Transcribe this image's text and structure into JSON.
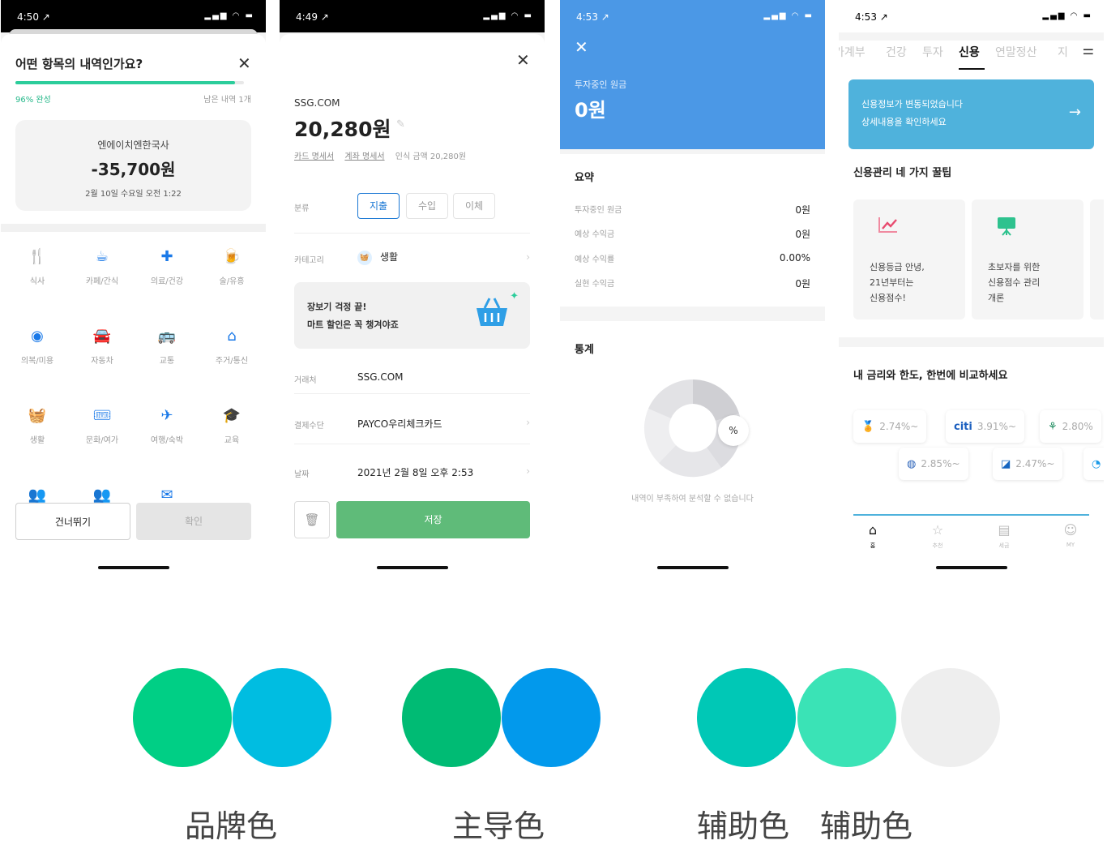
{
  "phone1": {
    "time": "4:50 ↗",
    "title": "어떤 항목의 내역인가요?",
    "progress": 0.96,
    "progress_text": "96% 완성",
    "remaining": "남은 내역 1개",
    "merchant": "엔에이치엔한국사",
    "amount": "-35,700원",
    "datetime": "2월 10일 수요일 오전 1:22",
    "categories": [
      {
        "icon": "fork-knife-icon",
        "label": "식사"
      },
      {
        "icon": "coffee-cup-icon",
        "label": "카페/간식"
      },
      {
        "icon": "medical-icon",
        "label": "의료/건강"
      },
      {
        "icon": "beer-icon",
        "label": "술/유흥"
      },
      {
        "icon": "mirror-icon",
        "label": "의복/미용"
      },
      {
        "icon": "car-icon",
        "label": "자동차"
      },
      {
        "icon": "bus-icon",
        "label": "교통"
      },
      {
        "icon": "house-icon",
        "label": "주거/통신"
      },
      {
        "icon": "basket-icon",
        "label": "생활"
      },
      {
        "icon": "ticket-icon",
        "label": "문화/여가"
      },
      {
        "icon": "plane-icon",
        "label": "여행/숙박"
      },
      {
        "icon": "graduation-cap-icon",
        "label": "교육"
      },
      {
        "icon": "people-icon",
        "label": ""
      },
      {
        "icon": "people-icon",
        "label": ""
      },
      {
        "icon": "envelope-icon",
        "label": ""
      }
    ],
    "skip_label": "건너뛰기",
    "confirm_label": "확인"
  },
  "phone2": {
    "time": "4:49 ↗",
    "merchant": "SSG.COM",
    "amount": "20,280원",
    "card_link": "카드 명세서",
    "account_link": "계좌 명세서",
    "recognized": "인식 금액 20,280원",
    "type_label": "분류",
    "types": [
      "지출",
      "수입",
      "이체"
    ],
    "category_label": "카테고리",
    "category_value": "생활",
    "promo_line1": "장보기 걱정 끝!",
    "promo_line2": "마트 할인은 꼭 챙겨야죠",
    "vendor_label": "거래처",
    "vendor_value": "SSG.COM",
    "payment_label": "결제수단",
    "payment_value": "PAYCO우리체크카드",
    "date_label": "날짜",
    "date_value": "2021년 2월 8일 오후 2:53",
    "save_label": "저장"
  },
  "phone3": {
    "time": "4:53 ↗",
    "invest_label": "투자중인 원금",
    "invest_value": "0원",
    "summary_title": "요약",
    "summary_rows": [
      {
        "label": "투자중인 원금",
        "value": "0원"
      },
      {
        "label": "예상 수익금",
        "value": "0원"
      },
      {
        "label": "예상 수익률",
        "value": "0.00%"
      },
      {
        "label": "실현 수익금",
        "value": "0원"
      }
    ],
    "stats_title": "통계",
    "pct_badge": "%",
    "empty_text": "내역이 부족하여 분석할 수 없습니다"
  },
  "phone4": {
    "time": "4:53 ↗",
    "tabs": [
      "가계부",
      "건강",
      "투자",
      "신용",
      "연말정산",
      "지"
    ],
    "active_tab": "신용",
    "banner_line1": "신용정보가 변동되었습니다",
    "banner_line2": "상세내용을 확인하세요",
    "tips_title": "신용관리 네 가지 꿀팁",
    "tip1": [
      "신용등급 안녕,",
      "21년부터는",
      "신용점수!"
    ],
    "tip2": [
      "초보자를 위한",
      "신용점수 관리",
      "개론"
    ],
    "compare_title": "내 금리와 한도, 한번에 비교하세요",
    "rates": [
      "2.74%~",
      "3.91%~",
      "2.80%",
      "2.85%~",
      "2.47%~"
    ],
    "rate_icons": [
      "medal-icon",
      "citi-logo",
      "bank-logo",
      "globe-logo",
      "mountain-logo"
    ],
    "citi_text": "citi",
    "nav": [
      {
        "icon": "home-icon",
        "label": "홈"
      },
      {
        "icon": "star-icon",
        "label": "추천"
      },
      {
        "icon": "document-icon",
        "label": "세금"
      },
      {
        "icon": "smile-icon",
        "label": "MY"
      }
    ]
  },
  "palette": {
    "groups": [
      {
        "label": "品牌色",
        "colors": [
          "#00cf85",
          "#00bde1"
        ]
      },
      {
        "label": "主导色",
        "colors": [
          "#00bb74",
          "#0299ec"
        ]
      },
      {
        "label": "辅助色",
        "colors": [
          "#00c8b6",
          "#3ae3b6"
        ]
      },
      {
        "label": "辅助色",
        "colors": [
          "#eeeeee"
        ]
      }
    ]
  },
  "colors": {
    "progress": "#2ccd9b",
    "icon_blue": "#1a79e8",
    "save_green": "#5fbb79",
    "header_blue": "#4b98e6",
    "banner_teal": "#4fb2dc"
  }
}
